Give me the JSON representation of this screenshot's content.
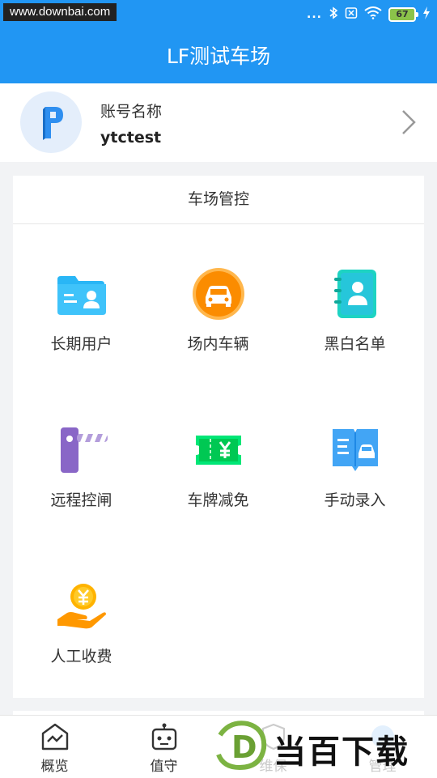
{
  "status_bar": {
    "watermark": "www.downbai.com",
    "dots": "...",
    "battery": "67"
  },
  "header": {
    "title": "LF测试车场"
  },
  "account": {
    "label": "账号名称",
    "name": "ytctest"
  },
  "panel": {
    "title": "车场管控",
    "items": [
      {
        "label": "长期用户",
        "icon": "user-card-icon"
      },
      {
        "label": "场内车辆",
        "icon": "car-icon"
      },
      {
        "label": "黑白名单",
        "icon": "contact-book-icon"
      },
      {
        "label": "远程控闸",
        "icon": "barrier-gate-icon"
      },
      {
        "label": "车牌减免",
        "icon": "coupon-icon"
      },
      {
        "label": "手动录入",
        "icon": "manual-entry-icon"
      },
      {
        "label": "人工收费",
        "icon": "payment-icon"
      }
    ]
  },
  "bottom_nav": [
    {
      "label": "概览",
      "icon": "overview-icon"
    },
    {
      "label": "值守",
      "icon": "robot-icon"
    },
    {
      "label": "维保",
      "icon": "maintenance-icon"
    },
    {
      "label": "管理",
      "icon": "management-icon"
    }
  ],
  "watermark_brand": {
    "text": "当百下载",
    "logo_letter": "D"
  }
}
